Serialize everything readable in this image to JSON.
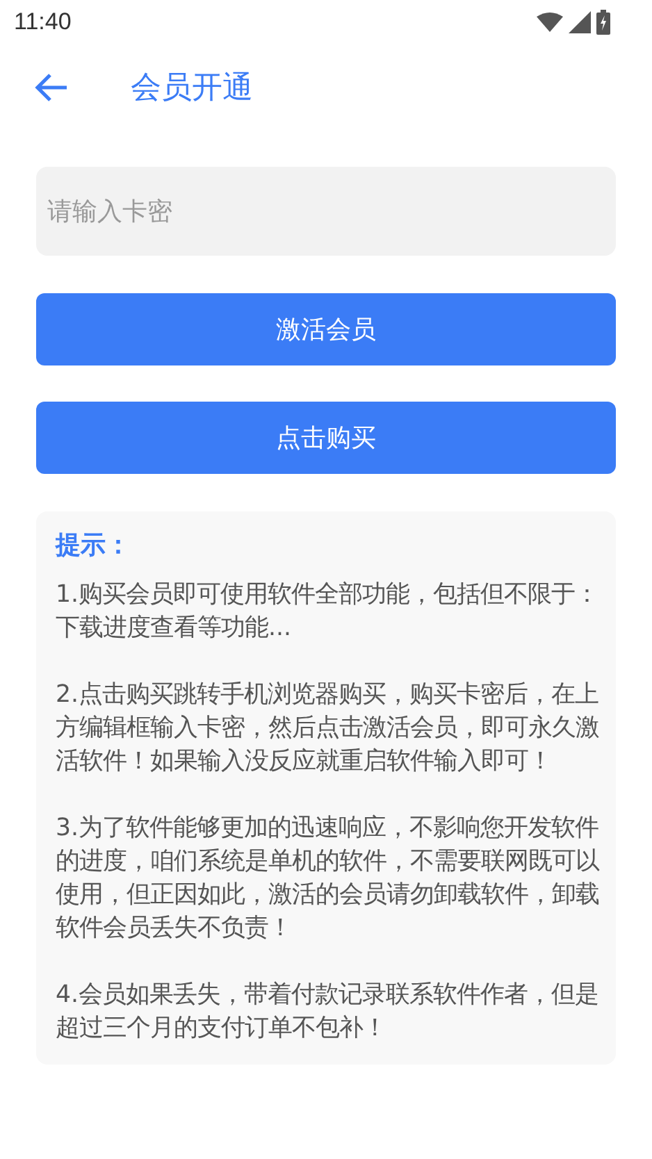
{
  "status_bar": {
    "time": "11:40"
  },
  "header": {
    "title": "会员开通"
  },
  "card_field": {
    "placeholder": "请输入卡密"
  },
  "buttons": [
    "激活会员",
    "点击购买"
  ],
  "tips": {
    "title": "提示：",
    "paragraphs": [
      "1.购买会员即可使用软件全部功能，包括但不限于：下载进度查看等功能...",
      "2.点击购买跳转手机浏览器购买，购买卡密后，在上方编辑框输入卡密，然后点击激活会员，即可永久激活软件！如果输入没反应就重启软件输入即可！",
      "3.为了软件能够更加的迅速响应，不影响您开发软件的进度，咱们系统是单机的软件，不需要联网既可以使用，但正因如此，激活的会员请勿卸载软件，卸载软件会员丢失不负责！",
      "4.会员如果丢失，带着付款记录联系软件作者，但是超过三个月的支付订单不包补！"
    ]
  }
}
